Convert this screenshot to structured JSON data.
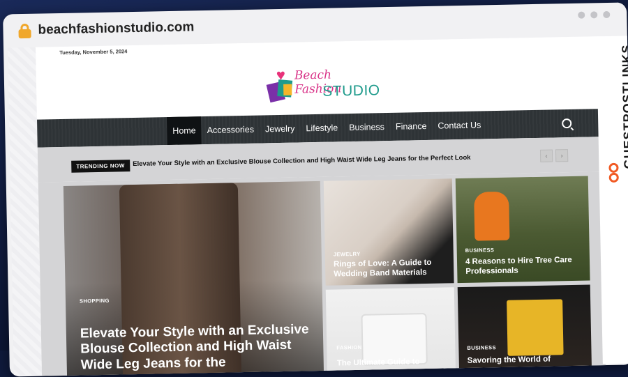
{
  "browser": {
    "url": "beachfashionstudio.com"
  },
  "site": {
    "date": "Tuesday, November 5, 2024",
    "logo_line1": "Beach Fashion",
    "logo_line2": "STUDIO"
  },
  "nav": {
    "items": [
      "Home",
      "Accessories",
      "Jewelry",
      "Lifestyle",
      "Business",
      "Finance",
      "Contact Us"
    ]
  },
  "trending": {
    "badge": "TRENDING NOW",
    "headline": "Elevate Your Style with an Exclusive Blouse Collection and High Waist Wide Leg Jeans for the Perfect Look"
  },
  "cards": [
    {
      "category": "SHOPPING",
      "title": "Elevate Your Style with an Exclusive Blouse Collection and High Waist Wide Leg Jeans for the"
    },
    {
      "category": "JEWELRY",
      "title": "Rings of Love: A Guide to Wedding Band Materials"
    },
    {
      "category": "BUSINESS",
      "title": "4 Reasons to Hire Tree Care Professionals"
    },
    {
      "category": "FASHION",
      "title": "The Ultimate Guide to"
    },
    {
      "category": "BUSINESS",
      "title": "Savoring the World of"
    }
  ],
  "sidebar": {
    "brand": "GUESTPOSTLINKS"
  },
  "colors": {
    "accent": "#f15a24",
    "nav_bg": "#2e3336",
    "logo_pink": "#d9368a",
    "logo_teal": "#1f9b8c"
  }
}
